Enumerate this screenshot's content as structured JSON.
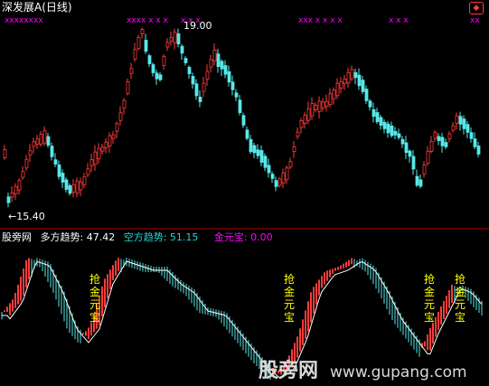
{
  "header": {
    "stock_name": "深发展A",
    "period": "(日线)"
  },
  "price": {
    "high_label": "19.00",
    "low_label": "←15.40"
  },
  "indicator": {
    "site": "股旁网",
    "bull_label": "多方趋势: ",
    "bull_value": "47.42",
    "bear_label": "空方趋势: ",
    "bear_value": "51.15",
    "gold_label": "金元宝: ",
    "gold_value": "0.00",
    "signal_text": [
      "抢",
      "金",
      "元",
      "宝"
    ]
  },
  "watermark": {
    "cn": "股旁网",
    "url": "www.gupang.com"
  },
  "colors": {
    "background": "#000000",
    "up": "#ff3b3b",
    "down": "#58e8e8",
    "text_white": "#ffffff",
    "text_yellow": "#ffff00",
    "text_cyan": "#22d6d6",
    "text_magenta": "#ff00ff",
    "divider": "#b00000"
  }
}
